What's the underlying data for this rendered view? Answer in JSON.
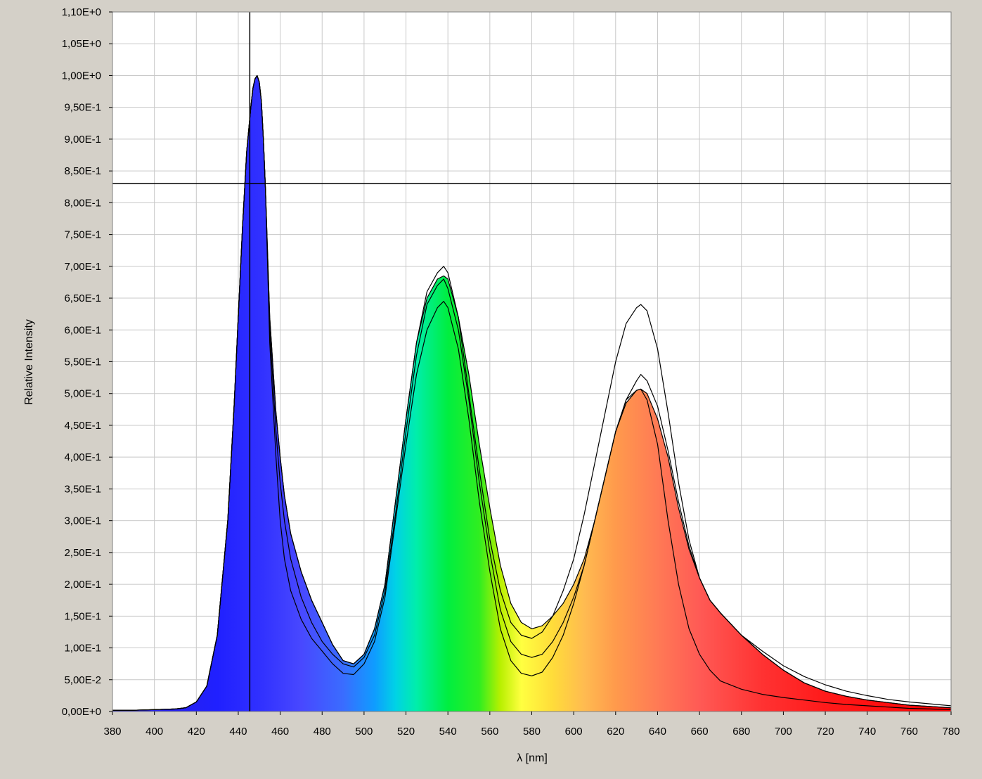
{
  "chart_data": {
    "type": "area",
    "xlabel": "λ [nm]",
    "ylabel": "Relative Intensity",
    "xlim": [
      380,
      780
    ],
    "ylim": [
      0,
      1.1
    ],
    "x_ticks": [
      380,
      400,
      420,
      440,
      460,
      480,
      500,
      520,
      540,
      560,
      580,
      600,
      620,
      640,
      660,
      680,
      700,
      720,
      740,
      760,
      780
    ],
    "x_tick_labels": [
      "380",
      "400",
      "420",
      "440",
      "460",
      "480",
      "500",
      "520",
      "540",
      "560",
      "580",
      "600",
      "620",
      "640",
      "660",
      "680",
      "700",
      "720",
      "740",
      "760",
      "780"
    ],
    "y_ticks": [
      0,
      0.05,
      0.1,
      0.15,
      0.2,
      0.25,
      0.3,
      0.35,
      0.4,
      0.45,
      0.5,
      0.55,
      0.6,
      0.65,
      0.7,
      0.75,
      0.8,
      0.85,
      0.9,
      0.95,
      1.0,
      1.05,
      1.1
    ],
    "y_tick_labels": [
      "0,00E+0",
      "5,00E-2",
      "1,00E-1",
      "1,50E-1",
      "2,00E-1",
      "2,50E-1",
      "3,00E-1",
      "3,50E-1",
      "4,00E-1",
      "4,50E-1",
      "5,00E-1",
      "5,50E-1",
      "6,00E-1",
      "6,50E-1",
      "7,00E-1",
      "7,50E-1",
      "8,00E-1",
      "8,50E-1",
      "9,00E-1",
      "9,50E-1",
      "1,00E+0",
      "1,05E+0",
      "1,10E+0"
    ],
    "grid": true,
    "cursor": {
      "x": 445.5,
      "y": 0.83
    },
    "x": [
      380,
      390,
      400,
      410,
      415,
      420,
      425,
      430,
      435,
      438,
      440,
      442,
      444,
      446,
      447,
      448,
      449,
      450,
      451,
      452,
      453,
      455,
      458,
      460,
      462,
      465,
      470,
      475,
      480,
      485,
      490,
      495,
      500,
      505,
      510,
      515,
      520,
      525,
      530,
      535,
      538,
      540,
      545,
      550,
      555,
      560,
      565,
      570,
      575,
      580,
      585,
      590,
      595,
      600,
      605,
      610,
      615,
      620,
      625,
      630,
      632,
      635,
      640,
      645,
      650,
      655,
      660,
      665,
      670,
      680,
      690,
      700,
      710,
      720,
      730,
      740,
      750,
      760,
      770,
      780
    ],
    "series": [
      {
        "fill": true,
        "values": [
          0.002,
          0.002,
          0.003,
          0.004,
          0.006,
          0.015,
          0.04,
          0.12,
          0.3,
          0.48,
          0.62,
          0.76,
          0.88,
          0.95,
          0.98,
          0.995,
          1.0,
          0.99,
          0.96,
          0.9,
          0.82,
          0.62,
          0.47,
          0.4,
          0.34,
          0.28,
          0.22,
          0.175,
          0.14,
          0.105,
          0.08,
          0.075,
          0.09,
          0.13,
          0.2,
          0.33,
          0.46,
          0.58,
          0.65,
          0.68,
          0.685,
          0.68,
          0.62,
          0.53,
          0.42,
          0.32,
          0.23,
          0.17,
          0.14,
          0.13,
          0.135,
          0.15,
          0.17,
          0.2,
          0.24,
          0.3,
          0.37,
          0.44,
          0.485,
          0.505,
          0.507,
          0.5,
          0.46,
          0.4,
          0.32,
          0.255,
          0.21,
          0.175,
          0.155,
          0.12,
          0.09,
          0.065,
          0.045,
          0.032,
          0.024,
          0.018,
          0.014,
          0.01,
          0.008,
          0.006
        ]
      },
      {
        "fill": false,
        "values": [
          0.002,
          0.002,
          0.003,
          0.004,
          0.006,
          0.015,
          0.04,
          0.12,
          0.3,
          0.48,
          0.62,
          0.76,
          0.88,
          0.95,
          0.98,
          0.995,
          1.0,
          0.99,
          0.96,
          0.9,
          0.82,
          0.62,
          0.47,
          0.4,
          0.34,
          0.28,
          0.22,
          0.175,
          0.14,
          0.105,
          0.08,
          0.075,
          0.09,
          0.13,
          0.2,
          0.33,
          0.46,
          0.58,
          0.66,
          0.69,
          0.7,
          0.69,
          0.62,
          0.5,
          0.38,
          0.27,
          0.19,
          0.14,
          0.12,
          0.115,
          0.125,
          0.15,
          0.19,
          0.24,
          0.31,
          0.39,
          0.47,
          0.55,
          0.61,
          0.635,
          0.64,
          0.63,
          0.57,
          0.47,
          0.36,
          0.27,
          0.21,
          0.175,
          0.155,
          0.12,
          0.095,
          0.072,
          0.055,
          0.042,
          0.032,
          0.025,
          0.019,
          0.015,
          0.012,
          0.009
        ]
      },
      {
        "fill": false,
        "values": [
          0.002,
          0.002,
          0.003,
          0.004,
          0.006,
          0.015,
          0.04,
          0.12,
          0.3,
          0.48,
          0.62,
          0.76,
          0.88,
          0.95,
          0.98,
          0.995,
          1.0,
          0.99,
          0.96,
          0.9,
          0.82,
          0.6,
          0.44,
          0.36,
          0.3,
          0.24,
          0.18,
          0.14,
          0.11,
          0.09,
          0.075,
          0.07,
          0.085,
          0.12,
          0.19,
          0.31,
          0.44,
          0.56,
          0.64,
          0.67,
          0.68,
          0.665,
          0.6,
          0.49,
          0.36,
          0.25,
          0.16,
          0.11,
          0.09,
          0.085,
          0.09,
          0.11,
          0.14,
          0.18,
          0.23,
          0.3,
          0.37,
          0.44,
          0.49,
          0.52,
          0.53,
          0.52,
          0.48,
          0.41,
          0.33,
          0.26,
          0.21,
          0.175,
          0.155,
          0.12,
          0.09,
          0.065,
          0.045,
          0.032,
          0.024,
          0.018,
          0.014,
          0.01,
          0.008,
          0.006
        ]
      },
      {
        "fill": false,
        "values": [
          0.002,
          0.002,
          0.003,
          0.004,
          0.006,
          0.015,
          0.04,
          0.12,
          0.3,
          0.48,
          0.62,
          0.76,
          0.88,
          0.95,
          0.98,
          0.995,
          1.0,
          0.99,
          0.96,
          0.9,
          0.82,
          0.58,
          0.4,
          0.3,
          0.24,
          0.19,
          0.145,
          0.115,
          0.095,
          0.075,
          0.06,
          0.058,
          0.075,
          0.11,
          0.18,
          0.3,
          0.42,
          0.53,
          0.6,
          0.635,
          0.645,
          0.635,
          0.57,
          0.46,
          0.33,
          0.22,
          0.13,
          0.08,
          0.06,
          0.056,
          0.062,
          0.085,
          0.12,
          0.17,
          0.23,
          0.3,
          0.37,
          0.44,
          0.49,
          0.505,
          0.507,
          0.49,
          0.42,
          0.3,
          0.2,
          0.13,
          0.09,
          0.065,
          0.048,
          0.035,
          0.027,
          0.022,
          0.018,
          0.014,
          0.011,
          0.009,
          0.007,
          0.005,
          0.004,
          0.003
        ]
      }
    ]
  }
}
